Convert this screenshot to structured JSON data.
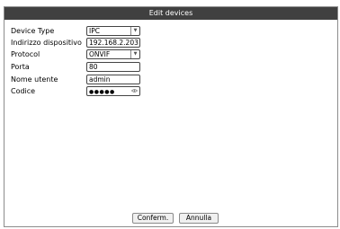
{
  "dialog": {
    "title": "Edit devices"
  },
  "form": {
    "device_type": {
      "label": "Device Type",
      "value": "IPC"
    },
    "address": {
      "label": "Indirizzo dispositivo",
      "value": "192.168.2.203"
    },
    "protocol": {
      "label": "Protocol",
      "value": "ONVIF"
    },
    "port": {
      "label": "Porta",
      "value": "80"
    },
    "username": {
      "label": "Nome utente",
      "value": "admin"
    },
    "password": {
      "label": "Codice",
      "value": "●●●●●"
    }
  },
  "buttons": {
    "confirm": "Conferm.",
    "cancel": "Annulla"
  },
  "icons": {
    "dropdown": "chevron-down-icon",
    "password_toggle": "eye-icon"
  },
  "colors": {
    "titlebar": "#404040",
    "titlebar_text": "#ffffff"
  }
}
